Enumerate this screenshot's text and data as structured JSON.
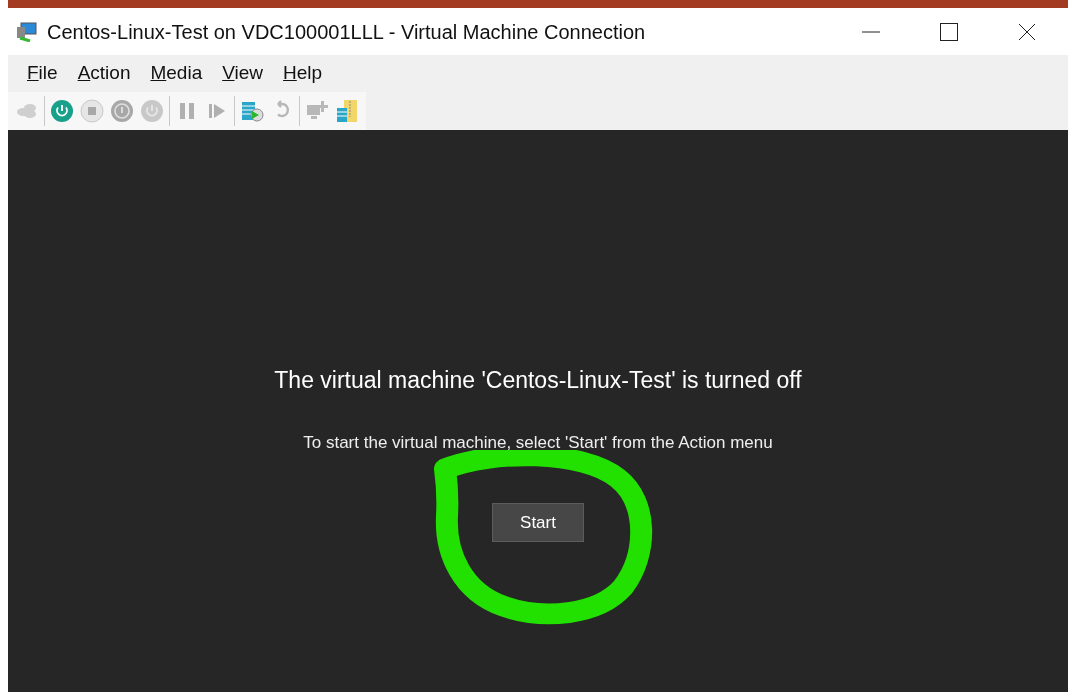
{
  "window": {
    "title": "Centos-Linux-Test on VDC100001LLL - Virtual Machine Connection"
  },
  "menu": [
    {
      "label": "File"
    },
    {
      "label": "Action"
    },
    {
      "label": "Media"
    },
    {
      "label": "View"
    },
    {
      "label": "Help"
    }
  ],
  "toolbar": [
    [
      {
        "kind": "ctrl-alt-del",
        "disabled": true
      }
    ],
    [
      {
        "kind": "start",
        "disabled": false
      },
      {
        "kind": "turn-off",
        "disabled": true
      },
      {
        "kind": "shut-down",
        "disabled": true
      },
      {
        "kind": "save",
        "disabled": true
      }
    ],
    [
      {
        "kind": "pause",
        "disabled": true
      },
      {
        "kind": "resume",
        "disabled": true
      }
    ],
    [
      {
        "kind": "checkpoint",
        "disabled": false
      },
      {
        "kind": "revert",
        "disabled": true
      }
    ],
    [
      {
        "kind": "enhanced-session",
        "disabled": true
      },
      {
        "kind": "share",
        "disabled": false
      }
    ]
  ],
  "screen": {
    "heading": "The virtual machine 'Centos-Linux-Test' is turned off",
    "message": "To start the virtual machine, select 'Start' from the Action menu",
    "button": "Start"
  }
}
